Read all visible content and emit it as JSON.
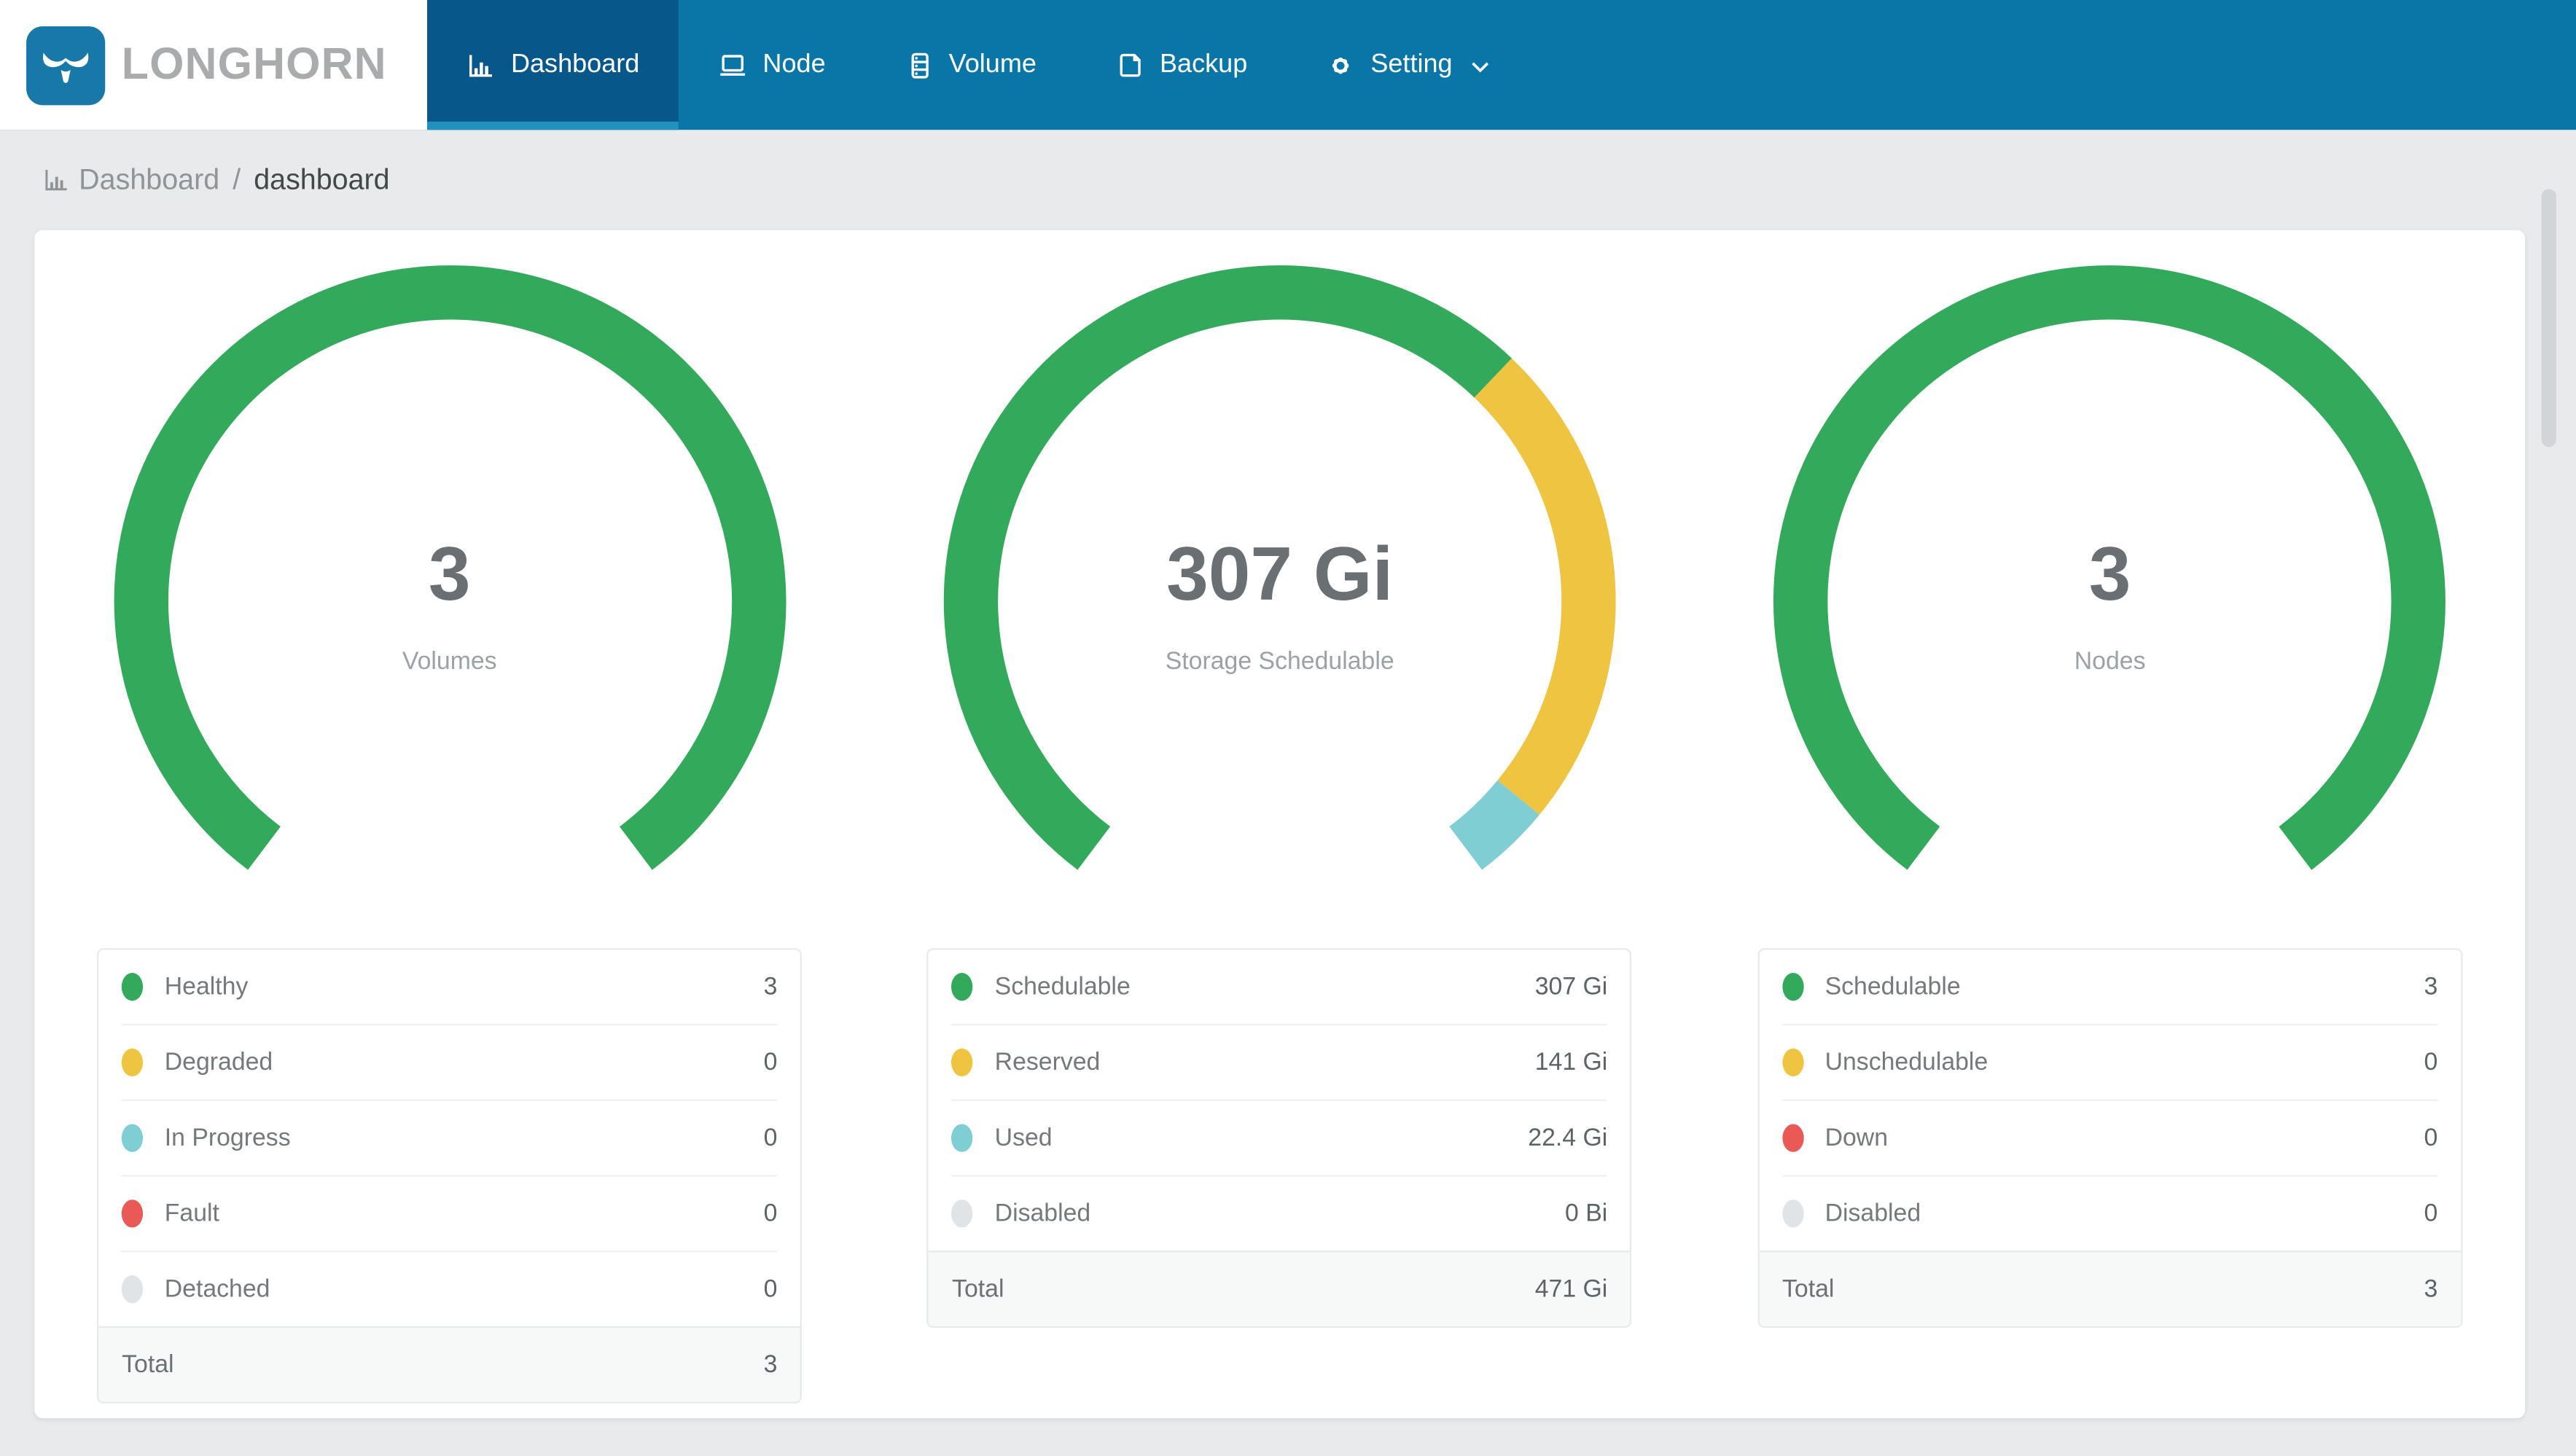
{
  "brand": {
    "name": "LONGHORN"
  },
  "nav": {
    "items": [
      {
        "label": "Dashboard",
        "icon": "bar-chart-icon",
        "active": true
      },
      {
        "label": "Node",
        "icon": "laptop-icon",
        "active": false
      },
      {
        "label": "Volume",
        "icon": "server-icon",
        "active": false
      },
      {
        "label": "Backup",
        "icon": "file-icon",
        "active": false
      },
      {
        "label": "Setting",
        "icon": "gear-icon",
        "active": false,
        "has_chevron": true
      }
    ]
  },
  "breadcrumb": {
    "icon": "bar-chart-icon",
    "section": "Dashboard",
    "separator": "/",
    "page": "dashboard"
  },
  "colors": {
    "navbar": "#0a76a8",
    "navbar_active": "#08578a",
    "navbar_indicator": "#2191c0",
    "green": "#33a95c",
    "yellow": "#efc441",
    "teal": "#7fced3",
    "red": "#e95955",
    "gray": "#e1e4e7"
  },
  "chart_data": [
    {
      "type": "gauge",
      "center_value": "3",
      "center_label": "Volumes",
      "arc_degrees": 286,
      "segments": [
        {
          "label": "Healthy",
          "value": 3,
          "display": "3",
          "color": "#33a95c"
        },
        {
          "label": "Degraded",
          "value": 0,
          "display": "0",
          "color": "#efc441"
        },
        {
          "label": "In Progress",
          "value": 0,
          "display": "0",
          "color": "#7fced3"
        },
        {
          "label": "Fault",
          "value": 0,
          "display": "0",
          "color": "#e95955"
        },
        {
          "label": "Detached",
          "value": 0,
          "display": "0",
          "color": "#e1e4e7"
        }
      ],
      "total": {
        "label": "Total",
        "display": "3"
      }
    },
    {
      "type": "gauge",
      "center_value": "307 Gi",
      "center_label": "Storage Schedulable",
      "arc_degrees": 286,
      "segments": [
        {
          "label": "Schedulable",
          "value": 307,
          "display": "307 Gi",
          "color": "#33a95c"
        },
        {
          "label": "Reserved",
          "value": 141,
          "display": "141 Gi",
          "color": "#efc441"
        },
        {
          "label": "Used",
          "value": 22.4,
          "display": "22.4 Gi",
          "color": "#7fced3"
        },
        {
          "label": "Disabled",
          "value": 0,
          "display": "0 Bi",
          "color": "#e1e4e7"
        }
      ],
      "total": {
        "label": "Total",
        "display": "471 Gi"
      }
    },
    {
      "type": "gauge",
      "center_value": "3",
      "center_label": "Nodes",
      "arc_degrees": 286,
      "segments": [
        {
          "label": "Schedulable",
          "value": 3,
          "display": "3",
          "color": "#33a95c"
        },
        {
          "label": "Unschedulable",
          "value": 0,
          "display": "0",
          "color": "#efc441"
        },
        {
          "label": "Down",
          "value": 0,
          "display": "0",
          "color": "#e95955"
        },
        {
          "label": "Disabled",
          "value": 0,
          "display": "0",
          "color": "#e1e4e7"
        }
      ],
      "total": {
        "label": "Total",
        "display": "3"
      }
    }
  ]
}
